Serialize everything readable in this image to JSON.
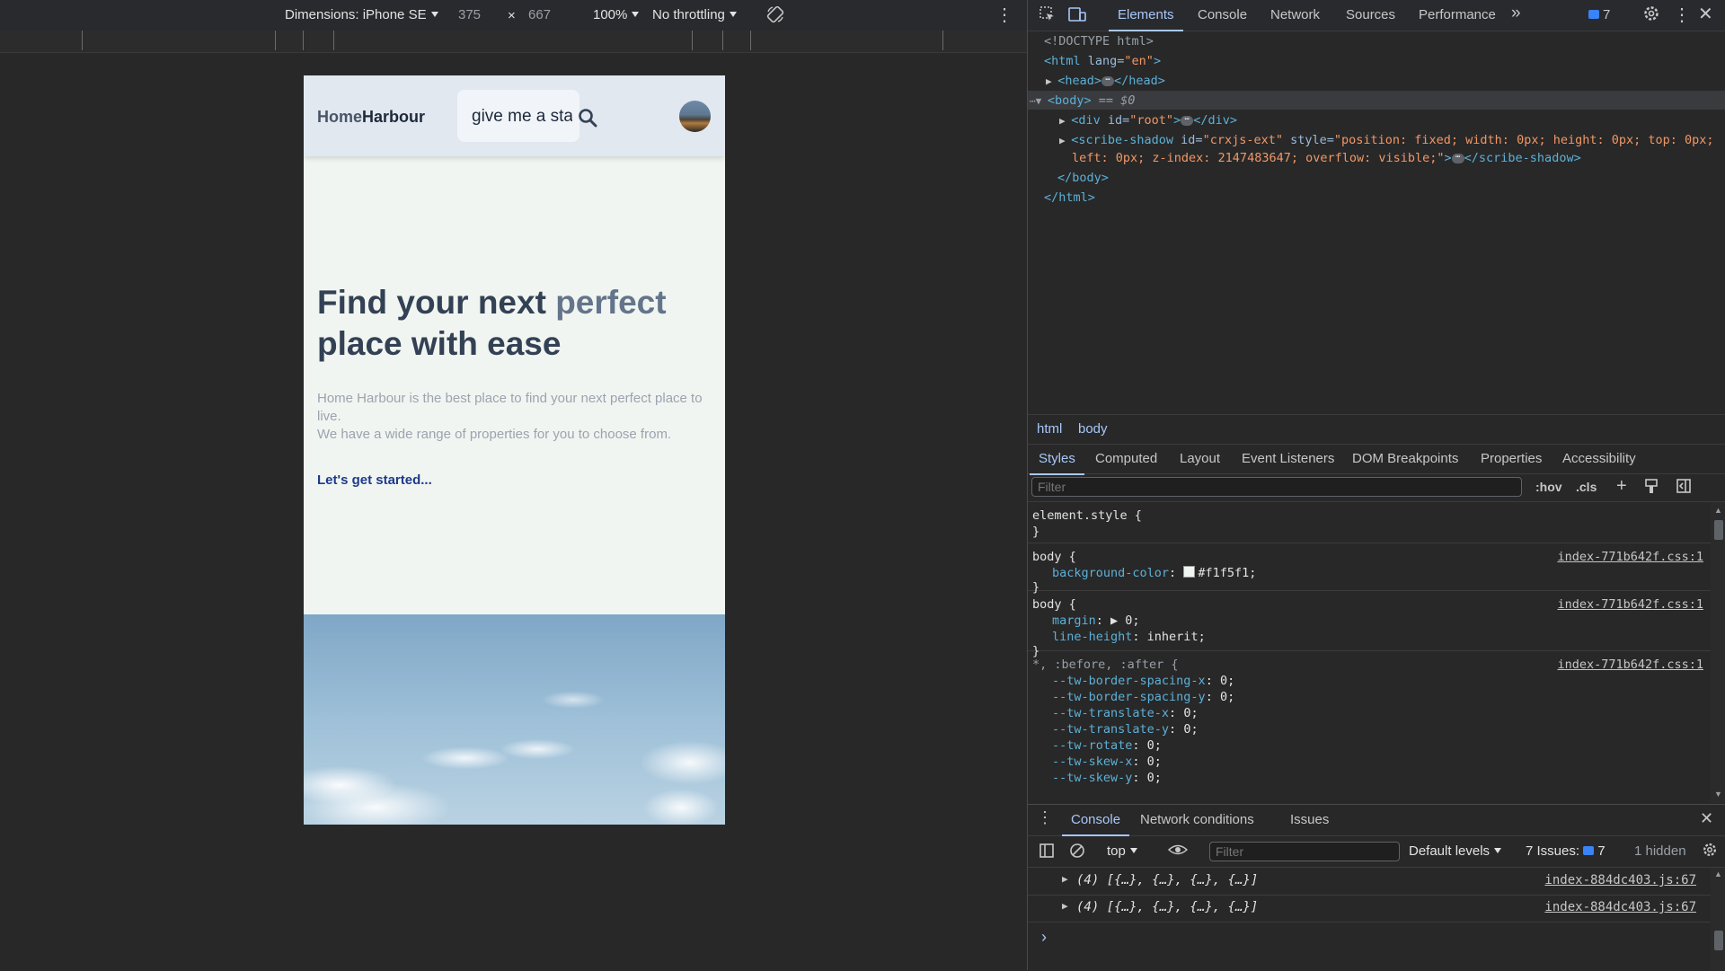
{
  "device_toolbar": {
    "device_label": "Dimensions: iPhone SE",
    "width": "375",
    "times": "×",
    "height": "667",
    "zoom": "100%",
    "throttling": "No throttling"
  },
  "page": {
    "brand_part1": "Home",
    "brand_part2": "Harbour",
    "search_value": "give me a star",
    "hero_title_1": "Find your next ",
    "hero_title_accent": "perfect",
    "hero_title_2": "place with ease",
    "hero_text_1": "Home Harbour is the best place to find your next perfect place to live.",
    "hero_text_2": "We have a wide range of properties for you to choose from.",
    "cta": "Let's get started..."
  },
  "devtools": {
    "tabs": [
      "Elements",
      "Console",
      "Network",
      "Sources",
      "Performance"
    ],
    "more": "»",
    "issues_count": "7",
    "dom": {
      "doctype": "<!DOCTYPE html>",
      "html_open_tag": "<html",
      "html_attr": " lang=",
      "html_attr_val": "\"en\"",
      "html_close_bracket": ">",
      "head": "<head>",
      "head_close": "</head>",
      "body": "<body>",
      "body_note": " == $0",
      "div_tag": "<div",
      "div_attr": " id=",
      "div_attr_val": "\"root\"",
      "div_close": "</div>",
      "scribe_tag": "<scribe-shadow",
      "scribe_attr1": " id=",
      "scribe_val1": "\"crxjs-ext\"",
      "scribe_attr2": " style=",
      "scribe_val2a": "\"position: fixed; width: 0px; height: 0px; top: 0px;",
      "scribe_val2b": "left: 0px; z-index: 2147483647; overflow: visible;\"",
      "scribe_close": "</scribe-shadow>",
      "body_close": "</body>",
      "html_close": "</html>"
    },
    "breadcrumbs": [
      "html",
      "body"
    ],
    "sub_tabs": [
      "Styles",
      "Computed",
      "Layout",
      "Event Listeners",
      "DOM Breakpoints",
      "Properties",
      "Accessibility"
    ],
    "styles_filter_placeholder": "Filter",
    "hov": ":hov",
    "cls": ".cls",
    "rules": {
      "element_style": "element.style {",
      "close": "}",
      "body_sel": "body {",
      "src": "index-771b642f.css:1",
      "bg_prop": "background-color",
      "bg_val": "#f1f5f1;",
      "margin_prop": "margin",
      "margin_val": "0;",
      "lh_prop": "line-height",
      "lh_val": "inherit;",
      "universal_sel": "*, :before, :after {",
      "tw": [
        [
          "--tw-border-spacing-x",
          "0;"
        ],
        [
          "--tw-border-spacing-y",
          "0;"
        ],
        [
          "--tw-translate-x",
          "0;"
        ],
        [
          "--tw-translate-y",
          "0;"
        ],
        [
          "--tw-rotate",
          "0;"
        ],
        [
          "--tw-skew-x",
          "0;"
        ],
        [
          "--tw-skew-y",
          "0;"
        ]
      ]
    },
    "drawer": {
      "tabs": [
        "Console",
        "Network conditions",
        "Issues"
      ],
      "context": "top",
      "filter_placeholder": "Filter",
      "levels": "Default levels",
      "issues_label": "7 Issues:",
      "issues_count": "7",
      "hidden": "1 hidden",
      "logs": [
        {
          "msg": "(4) [{…}, {…}, {…}, {…}]",
          "src": "index-884dc403.js:67"
        },
        {
          "msg": "(4) [{…}, {…}, {…}, {…}]",
          "src": "index-884dc403.js:67"
        }
      ],
      "prompt": "›"
    }
  }
}
